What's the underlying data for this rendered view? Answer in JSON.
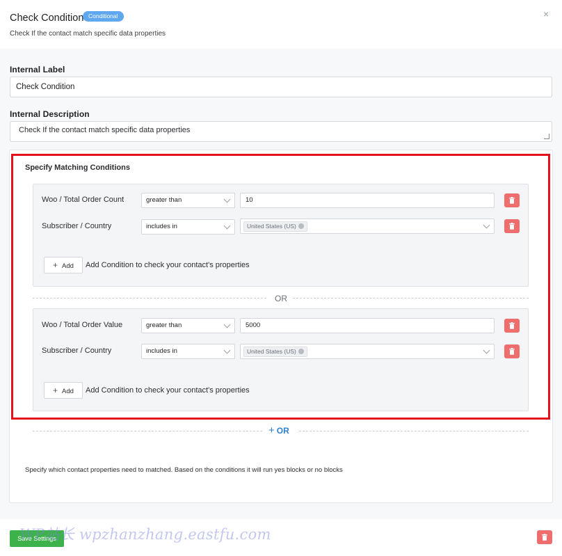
{
  "header": {
    "title": "Check Condition",
    "badge": "Conditional",
    "subtitle": "Check If the contact match specific data properties",
    "close": "×"
  },
  "fields": {
    "label_heading": "Internal Label",
    "label_value": "Check Condition",
    "description_heading": "Internal Description",
    "description_value": "Check If the contact match specific data properties"
  },
  "conditions": {
    "heading": "Specify Matching Conditions",
    "groups": [
      {
        "rows": [
          {
            "property": "Woo / Total Order Count",
            "operator": "greater than",
            "value": "10"
          },
          {
            "property": "Subscriber / Country",
            "operator": "includes in",
            "tag": "United States (US)"
          }
        ],
        "add_label": "Add",
        "add_hint": "Add Condition to check your contact's properties"
      },
      {
        "rows": [
          {
            "property": "Woo / Total Order Value",
            "operator": "greater than",
            "value": "5000"
          },
          {
            "property": "Subscriber / Country",
            "operator": "includes in",
            "tag": "United States (US)"
          }
        ],
        "add_label": "Add",
        "add_hint": "Add Condition to check your contact's properties"
      }
    ],
    "or_separator": "OR",
    "add_or_label": "OR",
    "footnote": "Specify which contact properties need to matched. Based on the conditions it will run yes blocks or no blocks"
  },
  "footer": {
    "save_label": "Save Settings",
    "watermark": "WP站长 wpzhanzhang.eastfu.com"
  },
  "colors": {
    "badge": "#5fa8f0",
    "delete": "#f06d6d",
    "save": "#3eb24a",
    "highlight": "#e6101a",
    "link": "#2f7fd0"
  }
}
